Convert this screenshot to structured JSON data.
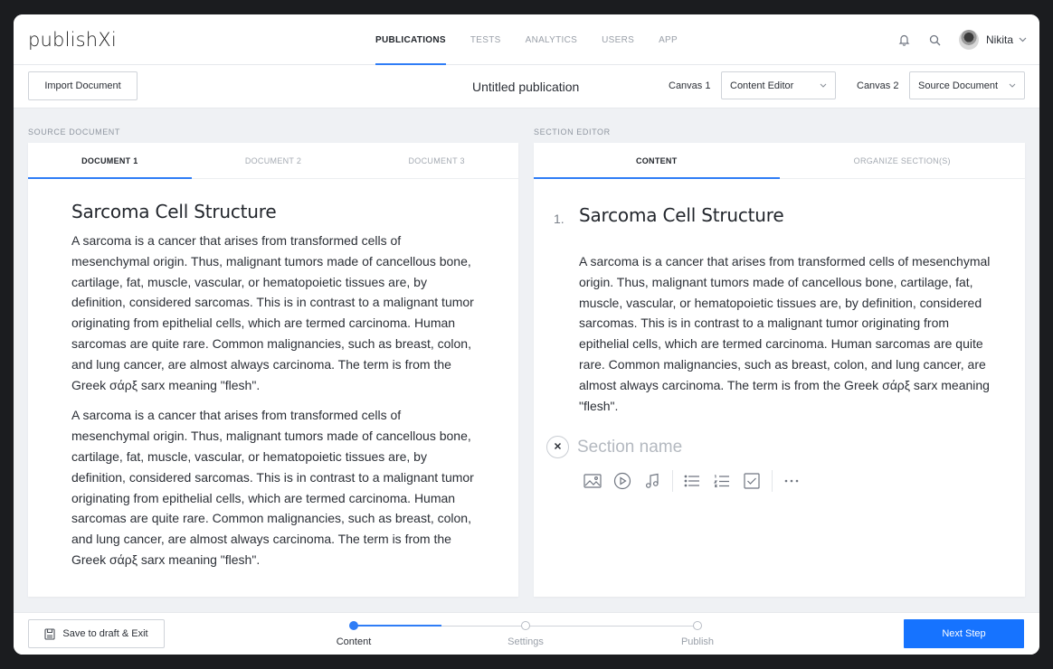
{
  "app": {
    "logo": "publishXi"
  },
  "nav": {
    "tabs": [
      {
        "label": "PUBLICATIONS",
        "active": true
      },
      {
        "label": "TESTS"
      },
      {
        "label": "ANALYTICS"
      },
      {
        "label": "USERS"
      },
      {
        "label": "APP"
      }
    ],
    "user": {
      "name": "Nikita"
    },
    "icons": [
      "bell-icon",
      "search-icon",
      "chevron-down-icon"
    ]
  },
  "toolbar": {
    "import_label": "Import Document",
    "publication_title": "Untitled publication",
    "canvas1": {
      "label": "Canvas 1",
      "value": "Content Editor"
    },
    "canvas2": {
      "label": "Canvas 2",
      "value": "Source Document"
    }
  },
  "source": {
    "section_label": "SOURCE DOCUMENT",
    "tabs": [
      {
        "label": "DOCUMENT 1",
        "active": true
      },
      {
        "label": "DOCUMENT 2"
      },
      {
        "label": "DOCUMENT 3"
      }
    ],
    "title": "Sarcoma Cell Structure",
    "paragraphs": [
      "A sarcoma is a cancer that arises from transformed cells of mesenchymal origin. Thus, malignant tumors made of cancellous bone, cartilage, fat, muscle, vascular, or hematopoietic tissues are, by definition, considered sarcomas. This is in contrast to a malignant tumor originating from epithelial cells, which are termed carcinoma. Human sarcomas are quite rare. Common malignancies, such as breast, colon, and lung cancer, are almost always carcinoma. The term is from the Greek σάρξ sarx meaning \"flesh\".",
      "A sarcoma is a cancer that arises from transformed cells of mesenchymal origin. Thus, malignant tumors made of cancellous bone, cartilage, fat, muscle, vascular, or hematopoietic tissues are, by definition, considered sarcomas. This is in contrast to a malignant tumor originating from epithelial cells, which are termed carcinoma. Human sarcomas are quite rare. Common malignancies, such as breast, colon, and lung cancer, are almost always carcinoma. The term is from the Greek σάρξ sarx meaning \"flesh\"."
    ]
  },
  "editor": {
    "section_label": "SECTION EDITOR",
    "tabs": [
      {
        "label": "CONTENT",
        "active": true
      },
      {
        "label": "ORGANIZE SECTION(S)"
      }
    ],
    "section_number": "1.",
    "title": "Sarcoma Cell Structure",
    "body": "A sarcoma is a cancer that arises from transformed cells of mesenchymal origin. Thus, malignant tumors made of cancellous bone, cartilage, fat, muscle, vascular, or hematopoietic tissues are, by definition, considered sarcomas. This is in contrast to a malignant tumor originating from epithelial cells, which are termed carcinoma. Human sarcomas are quite rare. Common malignancies, such as breast, colon, and lung cancer, are almost always carcinoma. The term is from the Greek σάρξ sarx meaning \"flesh\".",
    "new_section": {
      "placeholder": "Section name",
      "value": ""
    },
    "tool_icons": [
      "image-icon",
      "video-icon",
      "audio-icon",
      "bullet-list-icon",
      "numbered-list-icon",
      "checkbox-icon",
      "more-icon"
    ]
  },
  "footer": {
    "save_label": "Save to draft & Exit",
    "steps": [
      {
        "label": "Content",
        "done": true
      },
      {
        "label": "Settings"
      },
      {
        "label": "Publish"
      }
    ],
    "next_label": "Next Step"
  },
  "colors": {
    "accent": "#2f7df6",
    "primary_button": "#1673ff",
    "background": "#eff1f4"
  }
}
